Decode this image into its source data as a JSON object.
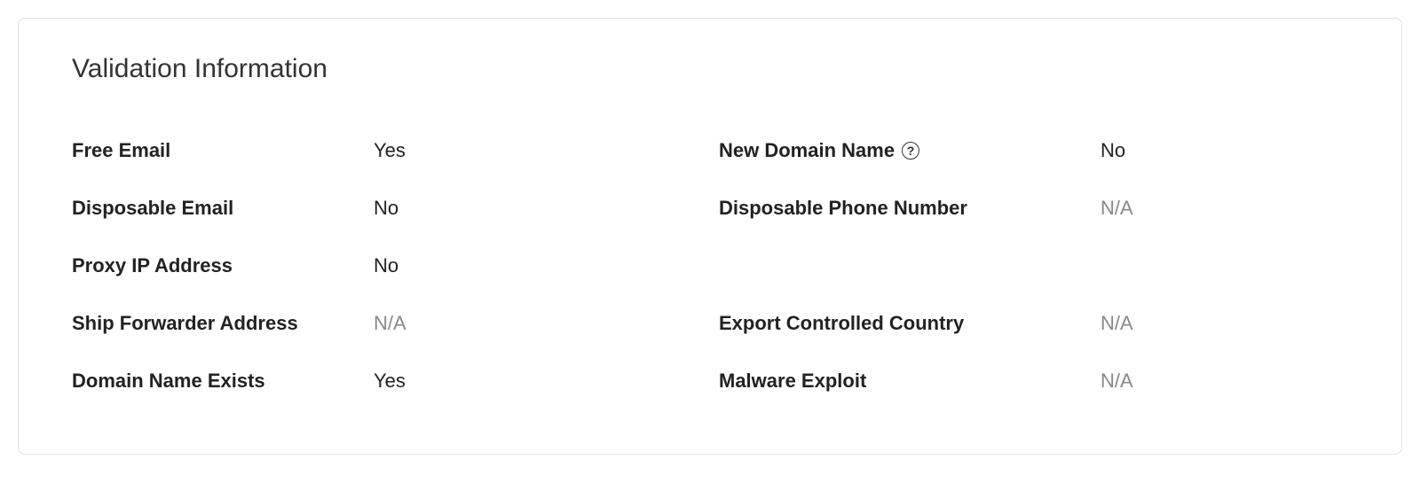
{
  "card": {
    "title": "Validation Information",
    "left": {
      "free_email": {
        "label": "Free Email",
        "value": "Yes",
        "na": false
      },
      "disposable_email": {
        "label": "Disposable Email",
        "value": "No",
        "na": false
      },
      "proxy_ip": {
        "label": "Proxy IP Address",
        "value": "No",
        "na": false
      },
      "ship_forwarder": {
        "label": "Ship Forwarder Address",
        "value": "N/A",
        "na": true
      },
      "domain_exists": {
        "label": "Domain Name Exists",
        "value": "Yes",
        "na": false
      }
    },
    "right": {
      "new_domain": {
        "label": "New Domain Name",
        "value": "No",
        "na": false,
        "help": true
      },
      "disposable_phone": {
        "label": "Disposable Phone Number",
        "value": "N/A",
        "na": true
      },
      "export_controlled": {
        "label": "Export Controlled Country",
        "value": "N/A",
        "na": true
      },
      "malware_exploit": {
        "label": "Malware Exploit",
        "value": "N/A",
        "na": true
      }
    }
  }
}
